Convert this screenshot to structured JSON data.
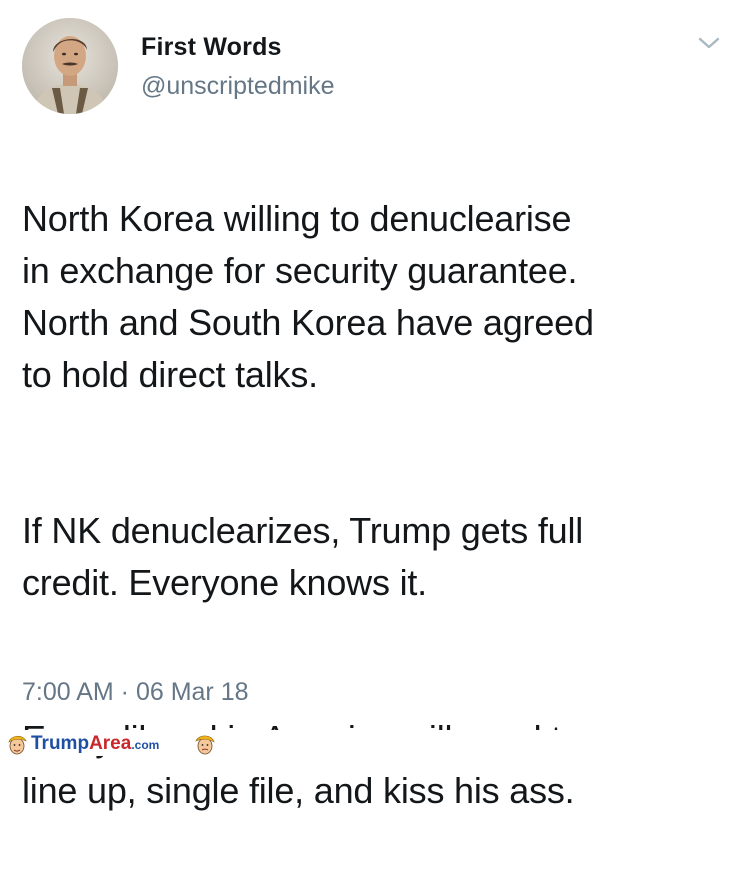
{
  "tweet": {
    "display_name": "First Words",
    "handle": "@unscriptedmike",
    "paragraphs": [
      "North Korea willing to denuclearise\nin exchange for security guarantee.\nNorth and South Korea have agreed\nto hold direct talks.",
      "If NK denuclearizes, Trump gets full\ncredit. Everyone knows it.",
      "Every liberal in America will need to\nline up, single file, and kiss his ass."
    ],
    "timestamp": "7:00 AM · 06 Mar 18",
    "menu_icon": "chevron-down-icon",
    "avatar_icon": "profile-photo"
  },
  "watermark": {
    "part1": "Trump",
    "part2": "Area",
    "part3": ".com"
  },
  "colors": {
    "text": "#14171a",
    "secondary": "#657786",
    "watermark_blue": "#1f4fa3",
    "watermark_red": "#c9272b"
  }
}
